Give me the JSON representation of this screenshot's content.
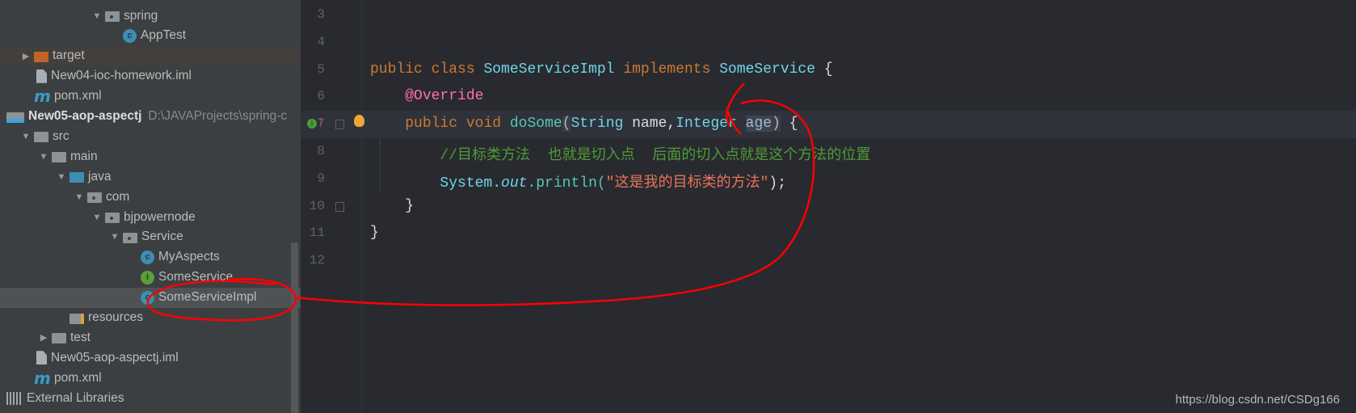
{
  "project_tree": {
    "items": [
      {
        "label": "spring",
        "icon": "package-folder-icon",
        "expanded": true,
        "level": 5
      },
      {
        "label": "AppTest",
        "icon": "test-class-icon",
        "level": 6
      },
      {
        "label": "target",
        "icon": "excluded-folder-icon",
        "expanded": false,
        "level": 1
      },
      {
        "label": "New04-ioc-homework.iml",
        "icon": "module-file-icon",
        "level": 1
      },
      {
        "label": "pom.xml",
        "icon": "maven-icon",
        "level": 1
      },
      {
        "label": "New05-aop-aspectj",
        "path": "D:\\JAVAProjects\\spring-c",
        "icon": "module-icon",
        "level": 0
      },
      {
        "label": "src",
        "icon": "folder-icon",
        "expanded": true,
        "level": 1
      },
      {
        "label": "main",
        "icon": "folder-icon",
        "expanded": true,
        "level": 2
      },
      {
        "label": "java",
        "icon": "source-folder-icon",
        "expanded": true,
        "level": 3
      },
      {
        "label": "com",
        "icon": "package-folder-icon",
        "expanded": true,
        "level": 4
      },
      {
        "label": "bjpowernode",
        "icon": "package-folder-icon",
        "expanded": true,
        "level": 5
      },
      {
        "label": "Service",
        "icon": "package-folder-icon",
        "expanded": true,
        "level": 6
      },
      {
        "label": "MyAspects",
        "icon": "class-icon",
        "level": 7
      },
      {
        "label": "SomeService",
        "icon": "interface-icon",
        "level": 7
      },
      {
        "label": "SomeServiceImpl",
        "icon": "class-icon",
        "level": 7,
        "selected": true
      },
      {
        "label": "resources",
        "icon": "resources-folder-icon",
        "level": 3
      },
      {
        "label": "test",
        "icon": "folder-icon",
        "expanded": false,
        "level": 2
      },
      {
        "label": "New05-aop-aspectj.iml",
        "icon": "module-file-icon",
        "level": 1
      },
      {
        "label": "pom.xml",
        "icon": "maven-icon",
        "level": 1
      },
      {
        "label": "External Libraries",
        "icon": "libraries-icon",
        "level": 0
      }
    ]
  },
  "editor": {
    "current_line": 7,
    "lines": [
      {
        "n": "3",
        "tokens": []
      },
      {
        "n": "4",
        "tokens": []
      },
      {
        "n": "5",
        "tokens": [
          [
            "kw",
            "public "
          ],
          [
            "kw",
            "class "
          ],
          [
            "ty",
            "SomeServiceImpl "
          ],
          [
            "kw",
            "implements "
          ],
          [
            "ty",
            "SomeService "
          ],
          [
            "pl",
            "{"
          ]
        ]
      },
      {
        "n": "6",
        "tokens": [
          [
            "pl",
            "    "
          ],
          [
            "an",
            "@Override"
          ]
        ]
      },
      {
        "n": "7",
        "tokens": [
          [
            "pl",
            "    "
          ],
          [
            "kw",
            "public "
          ],
          [
            "kw",
            "void "
          ],
          [
            "mt",
            "doSome"
          ],
          [
            "brace",
            "("
          ],
          [
            "ty",
            "String "
          ],
          [
            "pl",
            "name,"
          ],
          [
            "ty",
            "Integer "
          ],
          [
            "sel-age",
            "age"
          ],
          [
            "brace",
            ")"
          ],
          [
            "pl",
            " {"
          ]
        ]
      },
      {
        "n": "8",
        "tokens": [
          [
            "pl",
            "        "
          ],
          [
            "cm",
            "//目标类方法  也就是切入点  后面的切入点就是这个方法的位置"
          ]
        ]
      },
      {
        "n": "9",
        "tokens": [
          [
            "pl",
            "        "
          ],
          [
            "ty",
            "System."
          ],
          [
            "it",
            "out"
          ],
          [
            "mt",
            ".println("
          ],
          [
            "st",
            "\"这是我的目标类的方法\""
          ],
          [
            "pl",
            ");"
          ]
        ]
      },
      {
        "n": "10",
        "tokens": [
          [
            "pl",
            "    }"
          ]
        ]
      },
      {
        "n": "11",
        "tokens": [
          [
            "pl",
            "}"
          ]
        ]
      },
      {
        "n": "12",
        "tokens": []
      }
    ]
  },
  "watermark": "https://blog.csdn.net/CSDg166",
  "colors": {
    "annotation": "#ff0000",
    "sidebar_bg": "#3c3f41",
    "editor_bg": "#282a2f",
    "keyword": "#cc7832"
  }
}
